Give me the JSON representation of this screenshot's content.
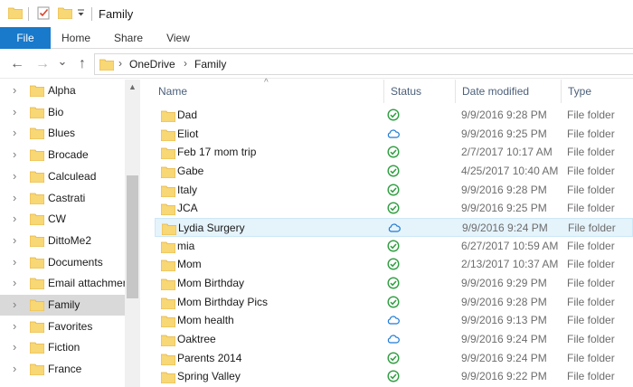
{
  "window": {
    "title": "Family"
  },
  "ribbon": {
    "tabs": [
      "File",
      "Home",
      "Share",
      "View"
    ]
  },
  "navigation": {
    "back_glyph": "←",
    "forward_glyph": "→",
    "recent_glyph": "⌄",
    "up_glyph": "↑",
    "breadcrumb": [
      "OneDrive",
      "Family"
    ],
    "crumb_separator": "›"
  },
  "navpane": {
    "items": [
      {
        "label": "Alpha",
        "selected": false
      },
      {
        "label": "Bio",
        "selected": false
      },
      {
        "label": "Blues",
        "selected": false
      },
      {
        "label": "Brocade",
        "selected": false
      },
      {
        "label": "Calculead",
        "selected": false
      },
      {
        "label": "Castrati",
        "selected": false
      },
      {
        "label": "CW",
        "selected": false
      },
      {
        "label": "DittoMe2",
        "selected": false
      },
      {
        "label": "Documents",
        "selected": false
      },
      {
        "label": "Email attachments",
        "selected": false
      },
      {
        "label": "Family",
        "selected": true
      },
      {
        "label": "Favorites",
        "selected": false
      },
      {
        "label": "Fiction",
        "selected": false
      },
      {
        "label": "France",
        "selected": false
      }
    ],
    "expander_glyph": "›",
    "scroll_up_glyph": "▲"
  },
  "columns": {
    "name": "Name",
    "status": "Status",
    "date_modified": "Date modified",
    "type": "Type",
    "sort_glyph": "^"
  },
  "files": [
    {
      "name": "Dad",
      "status": "synced",
      "date": "9/9/2016 9:28 PM",
      "type": "File folder"
    },
    {
      "name": "Eliot",
      "status": "cloud",
      "date": "9/9/2016 9:25 PM",
      "type": "File folder"
    },
    {
      "name": "Feb 17 mom trip",
      "status": "synced",
      "date": "2/7/2017 10:17 AM",
      "type": "File folder"
    },
    {
      "name": "Gabe",
      "status": "synced",
      "date": "4/25/2017 10:40 AM",
      "type": "File folder"
    },
    {
      "name": "Italy",
      "status": "synced",
      "date": "9/9/2016 9:28 PM",
      "type": "File folder"
    },
    {
      "name": "JCA",
      "status": "synced",
      "date": "9/9/2016 9:25 PM",
      "type": "File folder"
    },
    {
      "name": "Lydia Surgery",
      "status": "cloud",
      "date": "9/9/2016 9:24 PM",
      "type": "File folder",
      "hover": true
    },
    {
      "name": "mia",
      "status": "synced",
      "date": "6/27/2017 10:59 AM",
      "type": "File folder"
    },
    {
      "name": "Mom",
      "status": "synced",
      "date": "2/13/2017 10:37 AM",
      "type": "File folder"
    },
    {
      "name": "Mom Birthday",
      "status": "synced",
      "date": "9/9/2016 9:29 PM",
      "type": "File folder"
    },
    {
      "name": "Mom Birthday Pics",
      "status": "synced",
      "date": "9/9/2016 9:28 PM",
      "type": "File folder"
    },
    {
      "name": "Mom health",
      "status": "cloud",
      "date": "9/9/2016 9:13 PM",
      "type": "File folder"
    },
    {
      "name": "Oaktree",
      "status": "cloud",
      "date": "9/9/2016 9:24 PM",
      "type": "File folder"
    },
    {
      "name": "Parents 2014",
      "status": "synced",
      "date": "9/9/2016 9:24 PM",
      "type": "File folder"
    },
    {
      "name": "Spring Valley",
      "status": "synced",
      "date": "9/9/2016 9:22 PM",
      "type": "File folder"
    }
  ],
  "colors": {
    "accent": "#1979ca",
    "folder": "#f8d775",
    "folder_dark": "#e3b341",
    "synced": "#2e9d3f",
    "cloud": "#1e7bd6",
    "selected_bg": "#d9d9d9",
    "hover_bg": "#e5f3fb"
  },
  "icons": {
    "folder": "folder-icon",
    "synced": "green-check-circle-icon",
    "cloud": "blue-cloud-icon"
  }
}
